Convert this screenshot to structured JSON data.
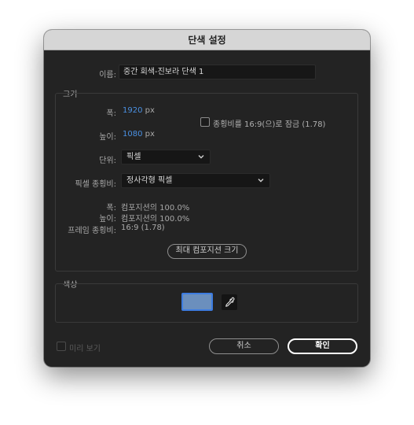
{
  "dialog": {
    "title": "단색 설정",
    "name_label": "이름:",
    "name_value": "중간 회색-진보라 단색 1"
  },
  "size": {
    "title": "크기",
    "width_label": "폭:",
    "width_value": "1920",
    "width_unit": "px",
    "height_label": "높이:",
    "height_value": "1080",
    "height_unit": "px",
    "lock_label": "종횡비를 16:9(으)로 잠금 (1.78)",
    "lock_checked": false,
    "units_label": "단위:",
    "units_value": "픽셀",
    "pixel_aspect_label": "픽셀 종횡비:",
    "pixel_aspect_value": "정사각형 픽셀",
    "comp_width_label": "폭:",
    "comp_width_value": "컴포지션의 100.0%",
    "comp_height_label": "높이:",
    "comp_height_value": "컴포지션의 100.0%",
    "frame_aspect_label": "프레임 종횡비:",
    "frame_aspect_value": "16:9 (1.78)",
    "max_comp_button": "최대 컴포지션 크기"
  },
  "color": {
    "title": "색상",
    "swatch_color": "#6b8fbd",
    "eyedropper_icon": "eyedropper-icon"
  },
  "footer": {
    "preview_label": "미리 보기",
    "preview_checked": false,
    "cancel_label": "취소",
    "ok_label": "확인"
  }
}
